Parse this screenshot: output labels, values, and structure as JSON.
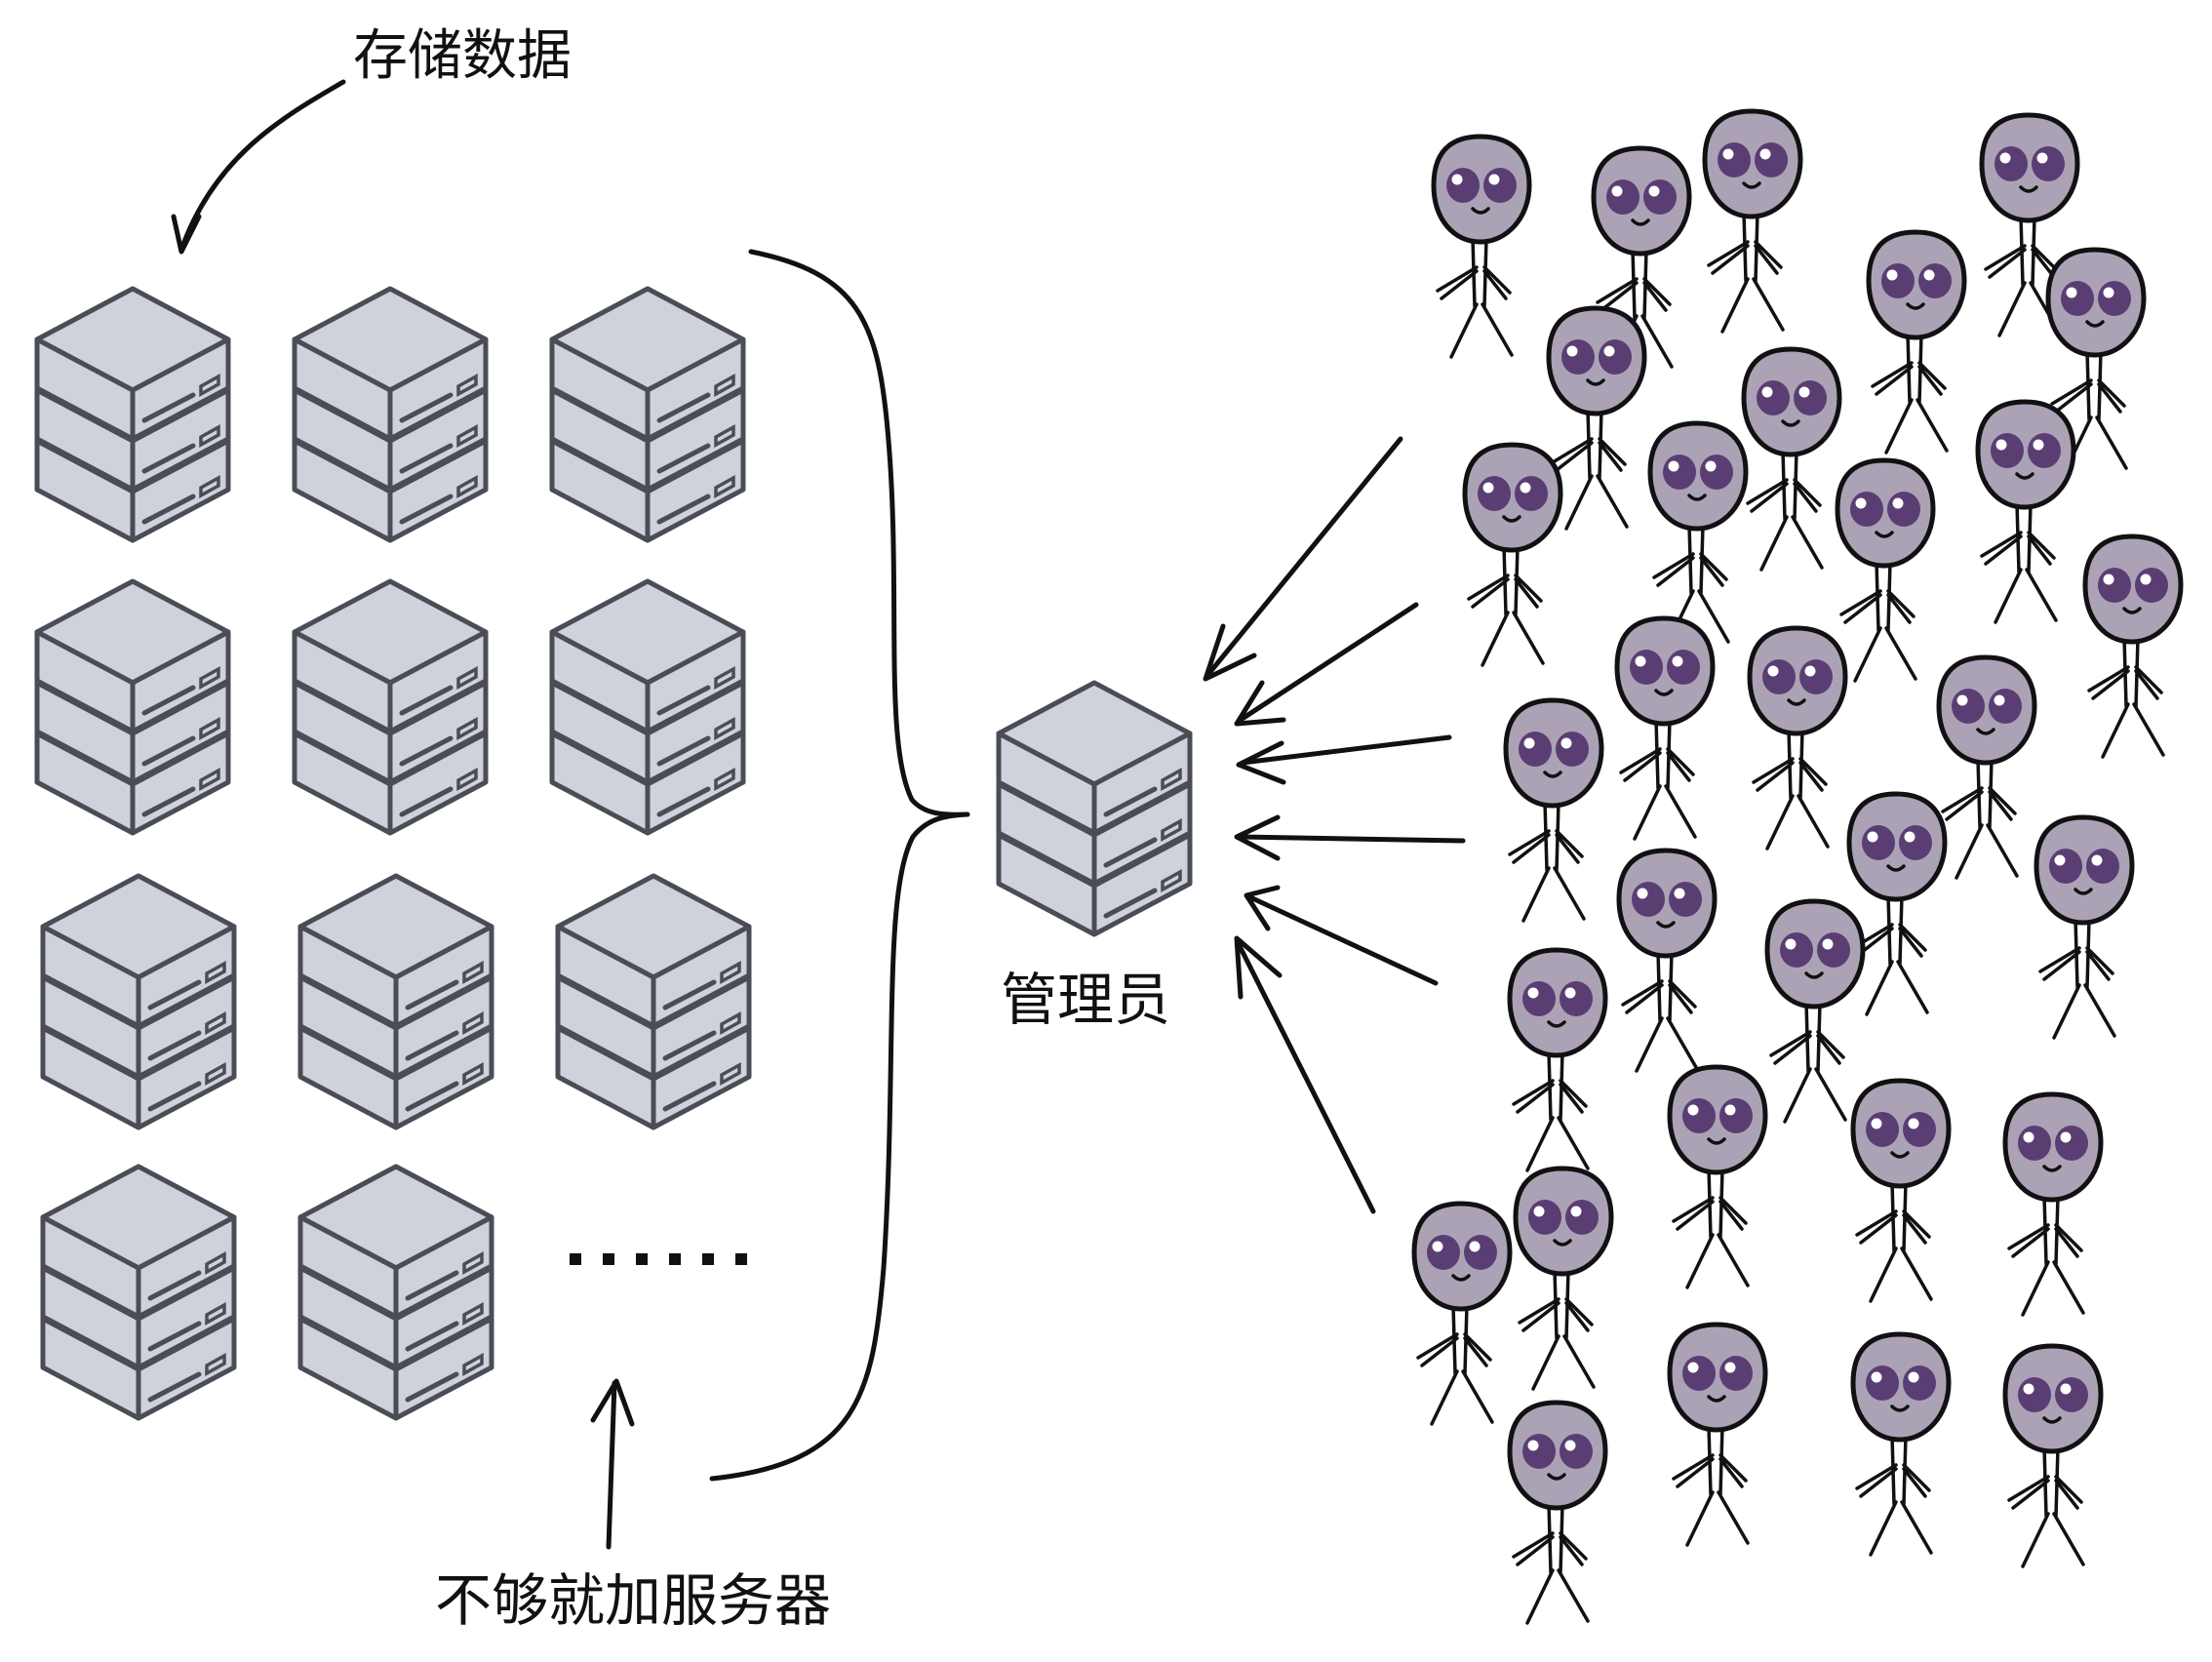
{
  "labels": {
    "store_data": "存储数据",
    "admin": "管理员",
    "add_servers": "不够就加服务器"
  },
  "colors": {
    "server_face": "#cfd2da",
    "server_stroke": "#4a4d55",
    "alien_head": "#aca2b6",
    "alien_eye": "#5a3e73",
    "line": "#111111"
  },
  "icons": {
    "server": "server-stack-icon",
    "alien": "alien-user-icon"
  }
}
